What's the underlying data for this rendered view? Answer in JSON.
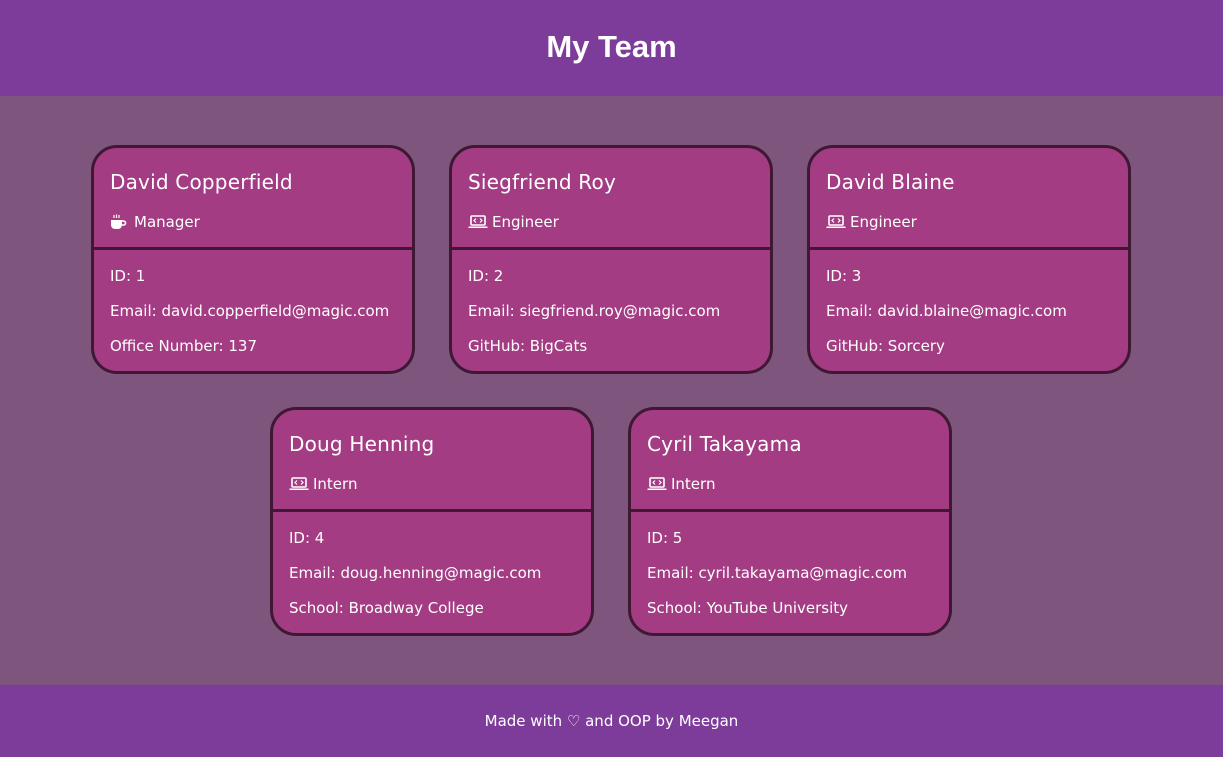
{
  "header": {
    "title": "My Team"
  },
  "cards": [
    {
      "name": "David Copperfield",
      "role": "Manager",
      "role_icon": "coffee-icon",
      "id": "ID: 1",
      "email": "Email: david.copperfield@magic.com",
      "extra": "Office Number: 137"
    },
    {
      "name": "Siegfriend Roy",
      "role": "Engineer",
      "role_icon": "laptop-code-icon",
      "id": "ID: 2",
      "email": "Email: siegfriend.roy@magic.com",
      "extra": "GitHub: BigCats"
    },
    {
      "name": "David Blaine",
      "role": "Engineer",
      "role_icon": "laptop-code-icon",
      "id": "ID: 3",
      "email": "Email: david.blaine@magic.com",
      "extra": "GitHub: Sorcery"
    },
    {
      "name": "Doug Henning",
      "role": "Intern",
      "role_icon": "laptop-code-icon",
      "id": "ID: 4",
      "email": "Email: doug.henning@magic.com",
      "extra": "School: Broadway College"
    },
    {
      "name": "Cyril Takayama",
      "role": "Intern",
      "role_icon": "laptop-code-icon",
      "id": "ID: 5",
      "email": "Email: cyril.takayama@magic.com",
      "extra": "School: YouTube University"
    }
  ],
  "footer": {
    "text": "Made with ♡ and OOP by Meegan"
  },
  "colors": {
    "header_bg": "#7d3b9a",
    "page_bg": "#7e557c",
    "card_bg": "#a43c84",
    "card_border": "#3f1834"
  }
}
